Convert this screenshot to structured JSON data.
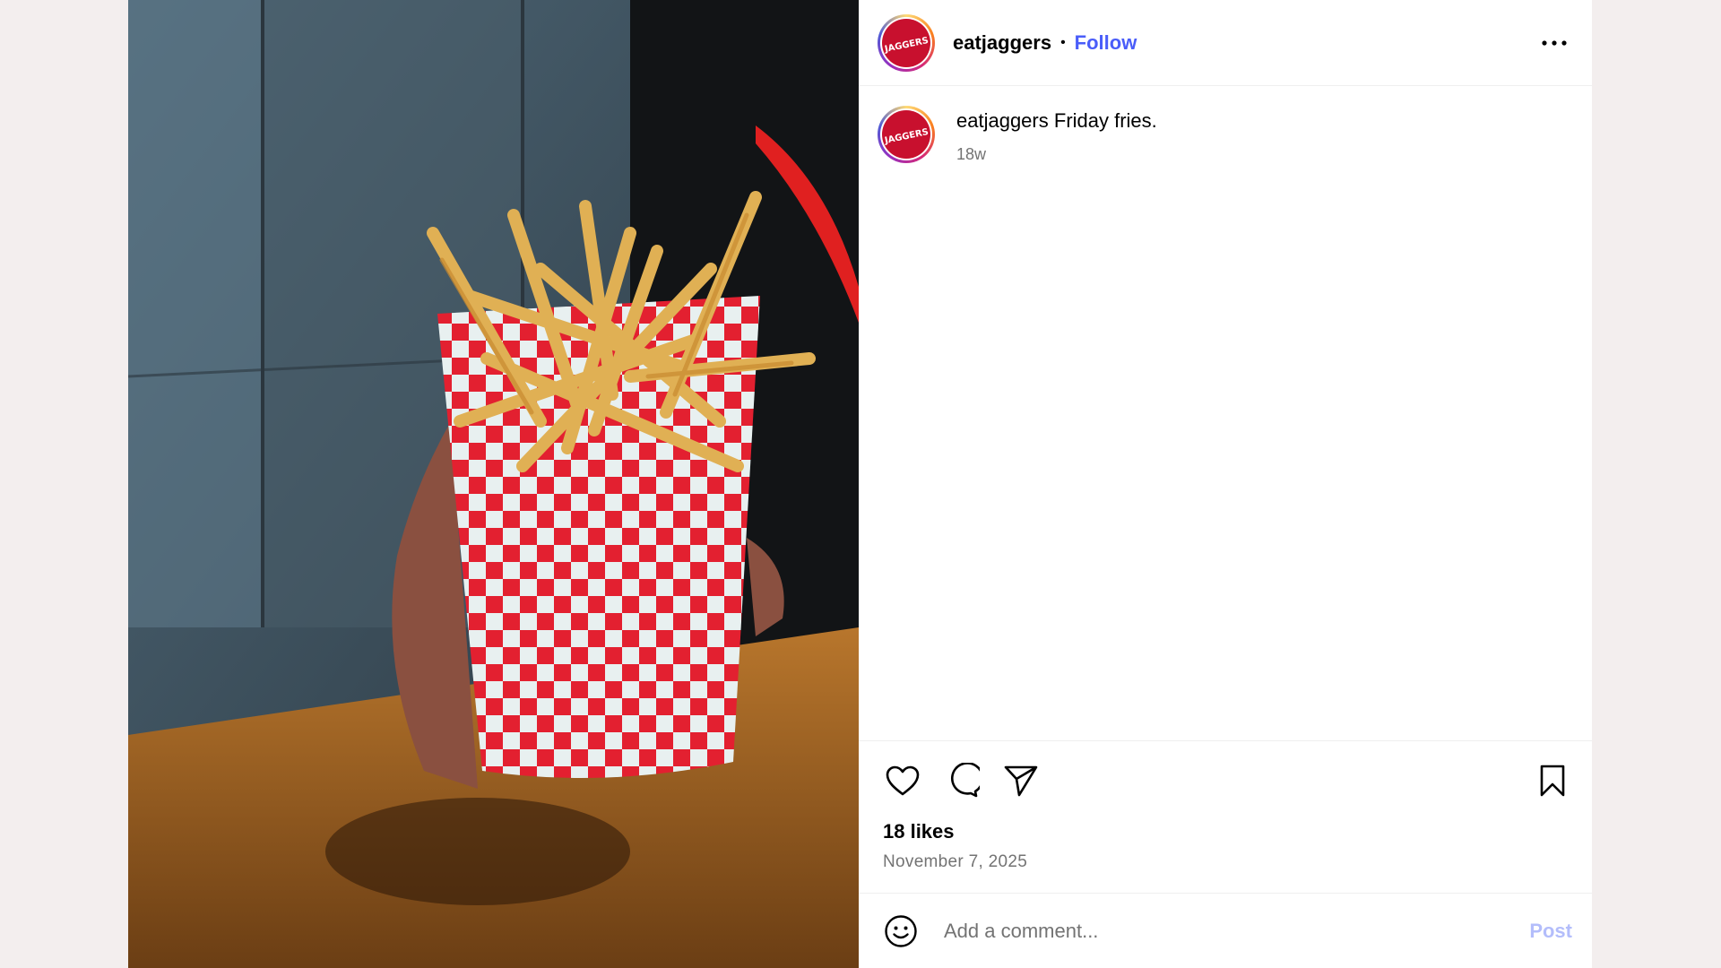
{
  "post": {
    "username": "eatjaggers",
    "follow_label": "Follow",
    "separator": "•",
    "logo_text": "JAGGERS",
    "caption": {
      "username": "eatjaggers",
      "text": "Friday fries."
    },
    "age": "18w",
    "likes": "18 likes",
    "date": "November 7, 2025",
    "comment": {
      "placeholder": "Add a comment...",
      "value": "",
      "post_label": "Post"
    },
    "icons": [
      "more-options-icon",
      "heart-icon",
      "comment-icon",
      "share-icon",
      "bookmark-icon",
      "emoji-icon"
    ],
    "colors": {
      "accent": "#4a5df9",
      "brand": "#c8102e",
      "post_button_disabled": "#b3bdfb"
    }
  }
}
